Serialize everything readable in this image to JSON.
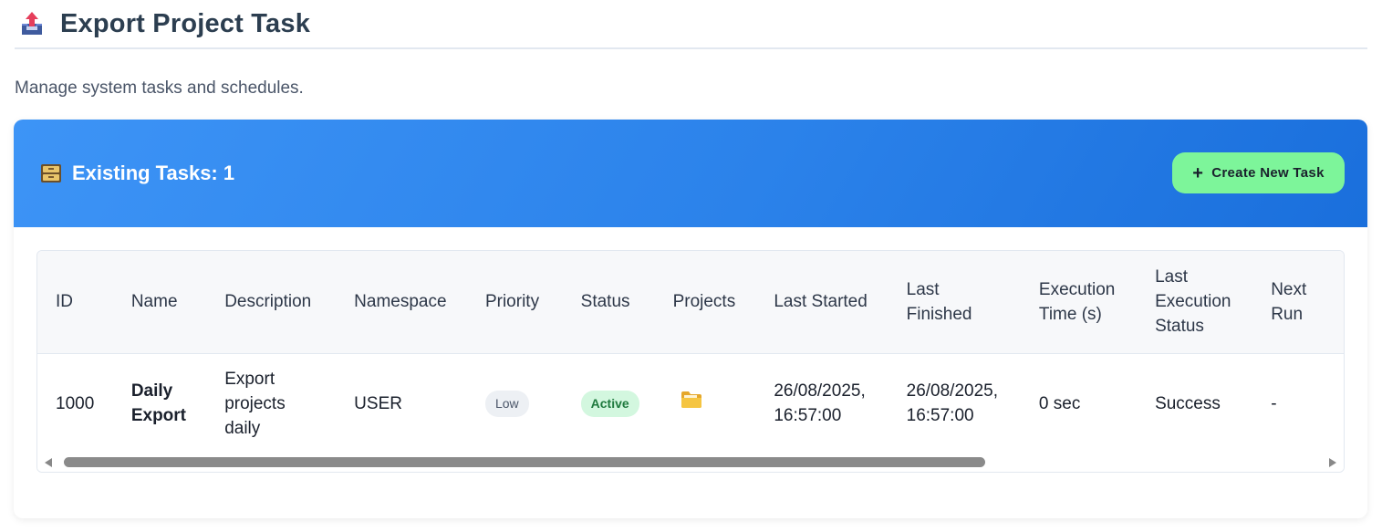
{
  "header": {
    "title": "Export Project Task",
    "icon": "export-tray-icon"
  },
  "subtitle": "Manage system tasks and schedules.",
  "card": {
    "title": "Existing Tasks: 1",
    "icon": "file-cabinet-icon",
    "create_button": {
      "label": "Create New Task",
      "icon": "+"
    },
    "accent_colors": {
      "header_gradient_start": "#3d94f6",
      "header_gradient_end": "#1a6fdc",
      "button_bg": "#7df59a"
    }
  },
  "table": {
    "columns": [
      "ID",
      "Name",
      "Description",
      "Namespace",
      "Priority",
      "Status",
      "Projects",
      "Last Started",
      "Last Finished",
      "Execution Time (s)",
      "Last Execution Status",
      "Next Run"
    ],
    "rows": [
      {
        "id": "1000",
        "name": "Daily Export",
        "description": "Export projects daily",
        "namespace": "USER",
        "priority": "Low",
        "status": "Active",
        "projects_icon": "folder-icon",
        "last_started": "26/08/2025, 16:57:00",
        "last_finished": "26/08/2025, 16:57:00",
        "execution_time": "0 sec",
        "last_execution_status": "Success",
        "next_run": "-"
      }
    ]
  }
}
